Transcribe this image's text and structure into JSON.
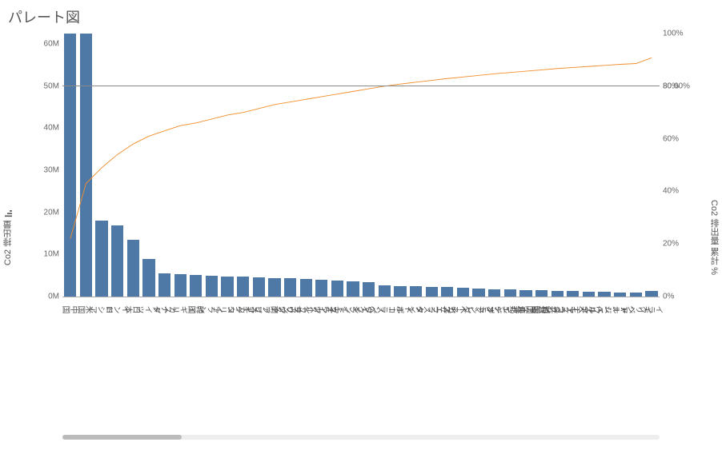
{
  "title": "パレート図",
  "left_axis_label": "Co2 排出量",
  "right_axis_label": "Co2 排出量 累計 %",
  "reference_line": {
    "pct": 80,
    "label": "80.00%"
  },
  "y_left_ticks": [
    0,
    10,
    20,
    30,
    40,
    50,
    60
  ],
  "y_left_tick_suffix": "M",
  "y_left_max": 62.5,
  "y_right_ticks": [
    0,
    20,
    40,
    60,
    80,
    100
  ],
  "y_right_tick_suffix": "%",
  "colors": {
    "bar": "#4e79a7",
    "line": "#f28e2b",
    "ref": "#888"
  },
  "chart_data": {
    "type": "bar",
    "title": "パレート図",
    "xlabel": "",
    "ylabel": "Co2 排出量",
    "y2label": "Co2 排出量 累計 %",
    "ylim": [
      0,
      62.5
    ],
    "y2lim": [
      0,
      100
    ],
    "categories": [
      "中国",
      "米国",
      "ロシア",
      "インド",
      "日本",
      "ドイツ",
      "カナダ",
      "イギリス",
      "韓国",
      "イラン",
      "イタリア",
      "メキシコ",
      "南アフリカ",
      "サウジアラビア",
      "フランス",
      "オーストラリア",
      "ブラジル",
      "インドネシア",
      "ウクライナ",
      "スペイン",
      "ポーランド",
      "トルコ",
      "タイ",
      "カザフスタン",
      "ベネズエラ",
      "マレーシア",
      "オランダ",
      "エジプト",
      "アルゼンチン",
      "パキスタン",
      "アラブ首長国連邦",
      "チェコ共和国",
      "ウズベキスタン",
      "ベルギー",
      "アルジェリア",
      "ベトナム",
      "ギリシャ",
      "イラク"
    ],
    "series": [
      {
        "name": "Co2 排出量 (M)",
        "type": "bar",
        "values": [
          62.5,
          62.5,
          18.0,
          17.0,
          13.5,
          9.0,
          5.5,
          5.3,
          5.1,
          5.0,
          4.8,
          4.7,
          4.6,
          4.4,
          4.3,
          4.1,
          4.0,
          3.8,
          3.6,
          3.4,
          2.6,
          2.5,
          2.4,
          2.3,
          2.2,
          2.1,
          1.9,
          1.8,
          1.7,
          1.6,
          1.5,
          1.4,
          1.3,
          1.2,
          1.1,
          1.0,
          0.9,
          1.4
        ]
      },
      {
        "name": "Co2 排出量 累計 %",
        "type": "line",
        "values": [
          22,
          43,
          49,
          54,
          58,
          61,
          63,
          65,
          66,
          67.5,
          69,
          70,
          71.5,
          73,
          74,
          75,
          76,
          77,
          78,
          79,
          80,
          80.8,
          81.5,
          82.2,
          82.9,
          83.5,
          84.1,
          84.7,
          85.2,
          85.7,
          86.2,
          86.7,
          87.1,
          87.5,
          87.9,
          88.3,
          88.6,
          90.8
        ]
      }
    ]
  }
}
